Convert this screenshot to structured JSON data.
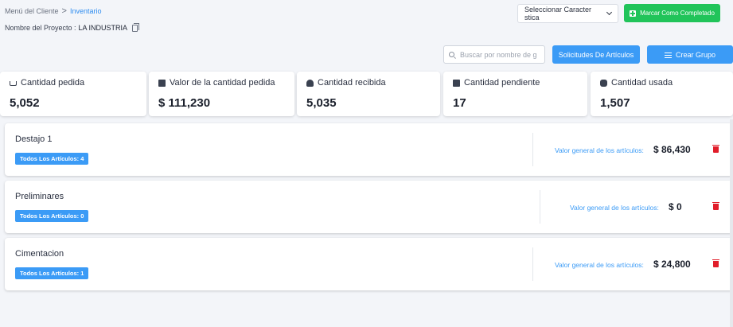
{
  "breadcrumb": {
    "parent": "Menú del Cliente",
    "separator": ">",
    "current": "Inventario"
  },
  "project": {
    "label": "Nombre del Proyecto :",
    "name": "LA INDUSTRIA"
  },
  "characteristic_select": {
    "value": "Seleccionar Caracter stica"
  },
  "mark_complete_label": "Marcar Como Completado",
  "search": {
    "placeholder": "Buscar por nombre de g",
    "value": ""
  },
  "requests_label": "Solicitudes De Artículos",
  "create_group_label": "Crear Grupo",
  "stats": [
    {
      "label": "Cantidad pedida",
      "value": "5,052",
      "icon": "cart-icon"
    },
    {
      "label": "Valor de la cantidad pedida",
      "value": "$ 111,230",
      "icon": "box-icon"
    },
    {
      "label": "Cantidad recibida",
      "value": "5,035",
      "icon": "hand-icon"
    },
    {
      "label": "Cantidad pendiente",
      "value": "17",
      "icon": "pending-icon"
    },
    {
      "label": "Cantidad usada",
      "value": "1,507",
      "icon": "users-icon"
    }
  ],
  "groups": [
    {
      "name": "Destajo 1",
      "tag": "Todos Los Artículos: 4",
      "value_label": "Valor general de los artículos:",
      "value": "$ 86,430"
    },
    {
      "name": "Preliminares",
      "tag": "Todos Los Artículos: 0",
      "value_label": "Valor general de los artículos:",
      "value": "$ 0"
    },
    {
      "name": "Cimentacion",
      "tag": "Todos Los Artículos: 1",
      "value_label": "Valor general de los artículos:",
      "value": "$ 24,800"
    }
  ],
  "colors": {
    "accent": "#3b9bf6",
    "success": "#21c45a",
    "danger": "#e11d2a"
  }
}
